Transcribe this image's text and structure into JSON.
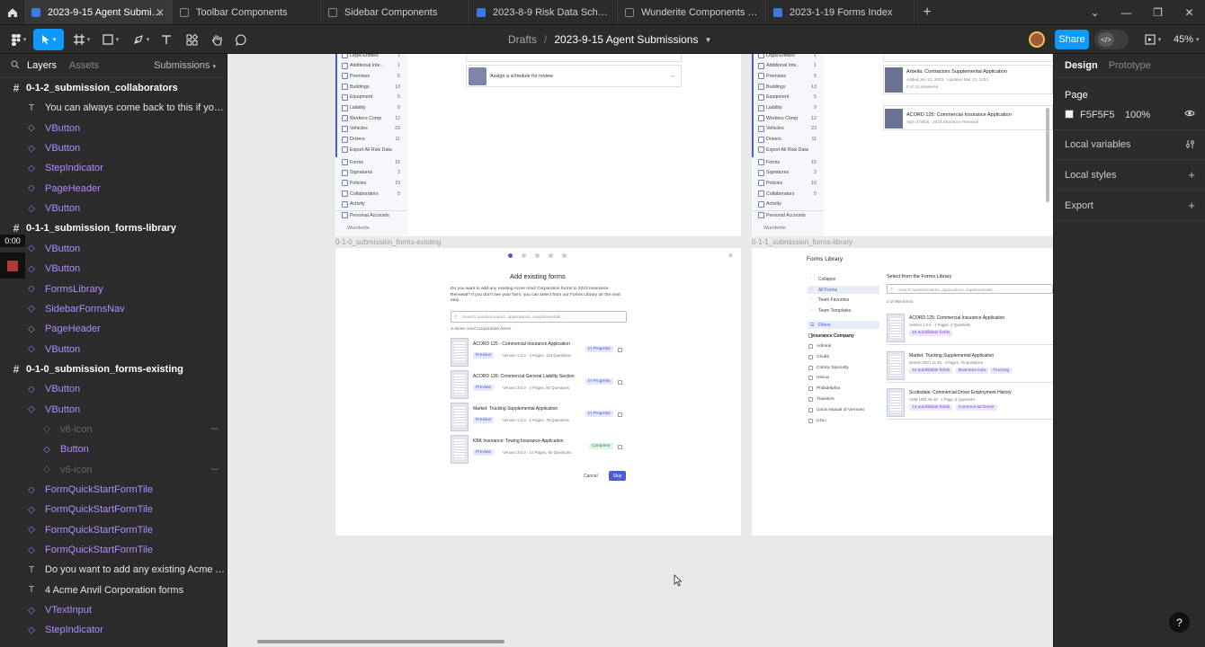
{
  "tabs": [
    {
      "label": "2023-9-15 Agent Submissions",
      "active": true,
      "icon": "design-file-icon"
    },
    {
      "label": "Toolbar Components",
      "active": false,
      "icon": "component-file-icon"
    },
    {
      "label": "Sidebar Components",
      "active": false,
      "icon": "component-file-icon"
    },
    {
      "label": "2023-8-9 Risk Data Schedule",
      "active": false,
      "icon": "design-file-icon"
    },
    {
      "label": "Wunderite Components & Colors",
      "active": false,
      "icon": "component-file-icon"
    },
    {
      "label": "2023-1-19 Forms Index",
      "active": false,
      "icon": "design-file-icon"
    }
  ],
  "toolbar": {
    "breadcrumb_root": "Drafts",
    "breadcrumb_sep": "/",
    "file_name": "2023-9-15 Agent Submissions",
    "share_label": "Share",
    "zoom": "45%",
    "devmode_glyph": "</>"
  },
  "left_panel": {
    "tab_layers": "Layers",
    "tab_assets": "Assets",
    "page_selector": "Submissions",
    "timer": "0:00",
    "layers": [
      {
        "kind": "frame",
        "indent": 0,
        "name": "0-1-2_submission_collaborators"
      },
      {
        "kind": "text",
        "indent": 1,
        "name": "You can always come back to this if you're not ready ..."
      },
      {
        "kind": "comp",
        "indent": 1,
        "name": "VButton"
      },
      {
        "kind": "comp",
        "indent": 1,
        "name": "VButton"
      },
      {
        "kind": "comp",
        "indent": 1,
        "name": "StepIndicator"
      },
      {
        "kind": "comp",
        "indent": 1,
        "name": "PageHeader"
      },
      {
        "kind": "comp",
        "indent": 1,
        "name": "VButton"
      },
      {
        "kind": "frame",
        "indent": 0,
        "name": "0-1-1_submission_forms-library"
      },
      {
        "kind": "comp",
        "indent": 1,
        "name": "VButton"
      },
      {
        "kind": "comp",
        "indent": 1,
        "name": "VButton"
      },
      {
        "kind": "comp",
        "indent": 1,
        "name": "FormsLibrary"
      },
      {
        "kind": "comp",
        "indent": 1,
        "name": "SidebarFormsNav"
      },
      {
        "kind": "comp",
        "indent": 1,
        "name": "PageHeader"
      },
      {
        "kind": "comp",
        "indent": 1,
        "name": "VButton"
      },
      {
        "kind": "frame",
        "indent": 0,
        "name": "0-1-0_submission_forms-existing"
      },
      {
        "kind": "comp",
        "indent": 1,
        "name": "VButton"
      },
      {
        "kind": "comp",
        "indent": 1,
        "name": "VButton"
      },
      {
        "kind": "faded",
        "indent": 2,
        "name": "v6-icon"
      },
      {
        "kind": "comp",
        "indent": 2,
        "name": "Button"
      },
      {
        "kind": "faded",
        "indent": 2,
        "name": "v6-icon"
      },
      {
        "kind": "comp",
        "indent": 1,
        "name": "FormQuickStartFormTile"
      },
      {
        "kind": "comp",
        "indent": 1,
        "name": "FormQuickStartFormTile"
      },
      {
        "kind": "comp",
        "indent": 1,
        "name": "FormQuickStartFormTile"
      },
      {
        "kind": "comp",
        "indent": 1,
        "name": "FormQuickStartFormTile"
      },
      {
        "kind": "text",
        "indent": 1,
        "name": "Do you want to add any existing Acme Anvil Corporat..."
      },
      {
        "kind": "text",
        "indent": 1,
        "name": "4 Acme Anvil Corporation forms"
      },
      {
        "kind": "comp",
        "indent": 1,
        "name": "VTextInput"
      },
      {
        "kind": "comp",
        "indent": 1,
        "name": "StepIndicator"
      }
    ]
  },
  "canvas": {
    "frame_label_existing": "0-1-0_submission_forms-existing",
    "frame_label_library": "0-1-1_submission_forms-library",
    "nav_items": [
      {
        "label": "Legal Entities",
        "count": "1"
      },
      {
        "label": "Additional Inte...",
        "count": "1"
      },
      {
        "label": "Premises",
        "count": "5"
      },
      {
        "label": "Buildings",
        "count": "13"
      },
      {
        "label": "Equipment",
        "count": "5"
      },
      {
        "label": "Liability",
        "count": "9"
      },
      {
        "label": "Workers Comp",
        "count": "12"
      },
      {
        "label": "Vehicles",
        "count": "23"
      },
      {
        "label": "Drivers",
        "count": "11"
      },
      {
        "label": "Export All Risk Data",
        "count": ""
      },
      {
        "label": "Forms",
        "count": "15"
      },
      {
        "label": "Signatures",
        "count": "3"
      },
      {
        "label": "Policies",
        "count": "10"
      },
      {
        "label": "Collaborators",
        "count": "5"
      },
      {
        "label": "Activity",
        "count": ""
      },
      {
        "label": "Personal Accounts",
        "count": ""
      }
    ],
    "sidebar_logo": "Wunderite",
    "schedule_prompt": "Assign a schedule for review",
    "right_top": {
      "item1_title": "Arbella: Contractors Supplemental Application",
      "item1_sub": "Added Jun 12, 2023 · Updated Mar 21, 2023",
      "item1_meta": "0 of 12 answered",
      "item2_title": "ACORD 125: Commercial Insurance Application",
      "item2_sub": "Sign 3 fields · 2023 Insurance Renewal"
    },
    "existing": {
      "title": "Add existing forms",
      "description": "Do you want to add any existing Acme Anvil Corporation forms to 2023 Insurance Renewal? If you don't see your form, you can select from our Forms Library on the next step.",
      "search_placeholder": "Search questionnaires, applications, supplementals, ...",
      "count_label": "4 Acme Anvil Corporation forms",
      "forms": [
        {
          "title": "ACORD 125 - Commercial Insurance Application",
          "meta": "Version 1.0.0 · 4 Pages, 115 Questions",
          "status": "In Progress"
        },
        {
          "title": "ACORD 126: Commercial General Liability Section",
          "meta": "Version 3.0.0 · 4 Pages, 92 Questions",
          "status": "In Progress"
        },
        {
          "title": "Markel: Trucking Supplemental Application",
          "meta": "Version 1.0.0 · 2 Pages, 76 Questions",
          "status": "In Progress"
        },
        {
          "title": "KBK Insurance: Towing Insurance Application",
          "meta": "Version 3.0.0 · 10 Pages, 80 Questions",
          "status": "Complete"
        }
      ],
      "preview_label": "Preview",
      "cancel_label": "Cancel",
      "skip_label": "Skip"
    },
    "library": {
      "title": "Forms Library",
      "select_heading": "Select from the Forms Library",
      "search_placeholder": "Search questionnaires, applications, supplementals, ...",
      "count_label": "3 of 969 forms",
      "nav": [
        "Collapse",
        "All Forms",
        "Team Favorites",
        "Team Templates"
      ],
      "filters_label": "Filters",
      "company_label": "Insurance Company",
      "companies": [
        "Admiral",
        "Chubb",
        "Colony Specialty",
        "Hiscox",
        "Philadelphia",
        "Travelers",
        "Union Mutual of Vermont",
        "USLI"
      ],
      "forms": [
        {
          "title": "ACORD 125: Commercial Insurance Application",
          "meta": "Version 1.0.0 · 4 Pages, 4 Questions",
          "tags": [
            "15 autofillable fields"
          ]
        },
        {
          "title": "Markel: Trucking Supplemental Application",
          "meta": "MAMIC 0071 11 03 · 3 Pages, 76 Questions",
          "tags": [
            "14 autofillable fields",
            "Business Auto",
            "Trucking"
          ]
        },
        {
          "title": "Scottsdale: Commercial Driver Employment History",
          "meta": "ADM 1031 05-15 · 1 Page, 6 Questions",
          "tags": [
            "13 autofillable fields",
            "Commercial Driver"
          ]
        }
      ]
    }
  },
  "right_panel": {
    "tab_design": "Design",
    "tab_prototype": "Prototype",
    "page_heading": "Page",
    "page_color": "F5F5F5",
    "page_opacity": "100%",
    "local_variables": "Local variables",
    "local_styles": "Local styles",
    "export": "Export"
  },
  "help_glyph": "?",
  "colors": {
    "accent": "#0d99ff",
    "component": "#b08cff",
    "frame_bg": "#2c2c2c",
    "canvas_bg": "#e9e9e9",
    "art_primary": "#4c5bd4"
  }
}
